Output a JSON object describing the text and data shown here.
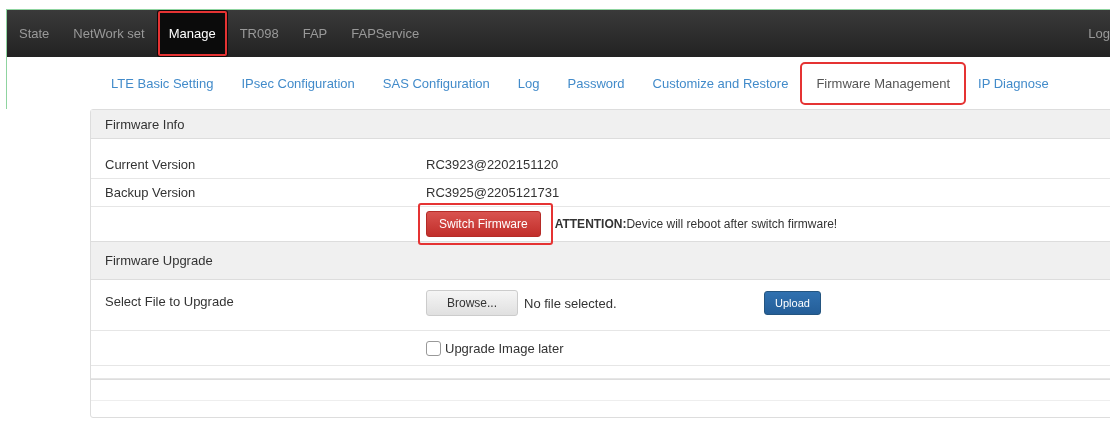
{
  "navbar": {
    "items": [
      {
        "label": "State",
        "selected": false,
        "highlighted": false
      },
      {
        "label": "NetWork set",
        "selected": false,
        "highlighted": false
      },
      {
        "label": "Manage",
        "selected": true,
        "highlighted": true
      },
      {
        "label": "TR098",
        "selected": false,
        "highlighted": false
      },
      {
        "label": "FAP",
        "selected": false,
        "highlighted": false
      },
      {
        "label": "FAPService",
        "selected": false,
        "highlighted": false
      }
    ],
    "right_link": "Log"
  },
  "tabs": [
    {
      "label": "LTE Basic Setting",
      "selected": false,
      "highlighted": false
    },
    {
      "label": "IPsec Configuration",
      "selected": false,
      "highlighted": false
    },
    {
      "label": "SAS Configuration",
      "selected": false,
      "highlighted": false
    },
    {
      "label": "Log",
      "selected": false,
      "highlighted": false
    },
    {
      "label": "Password",
      "selected": false,
      "highlighted": false
    },
    {
      "label": "Customize and Restore",
      "selected": false,
      "highlighted": false
    },
    {
      "label": "Firmware Management",
      "selected": true,
      "highlighted": true
    },
    {
      "label": "IP Diagnose",
      "selected": false,
      "highlighted": false
    }
  ],
  "firmware_info": {
    "heading": "Firmware Info",
    "rows": [
      {
        "label": "Current Version",
        "value": "RC3923@2202151120"
      },
      {
        "label": "Backup Version",
        "value": "RC3925@2205121731"
      }
    ],
    "switch_button": {
      "label": "Switch Firmware",
      "highlighted": true
    },
    "notice": "**ATTENTION:**Device will reboot after switch firmware!"
  },
  "firmware_upgrade": {
    "heading": "Firmware Upgrade",
    "file_label": "Select File to Upgrade",
    "browse_button": "Browse...",
    "file_status": "No file selected.",
    "upload_button": "Upload",
    "later_checkbox": {
      "label": "Upgrade Image later",
      "checked": false
    }
  }
}
